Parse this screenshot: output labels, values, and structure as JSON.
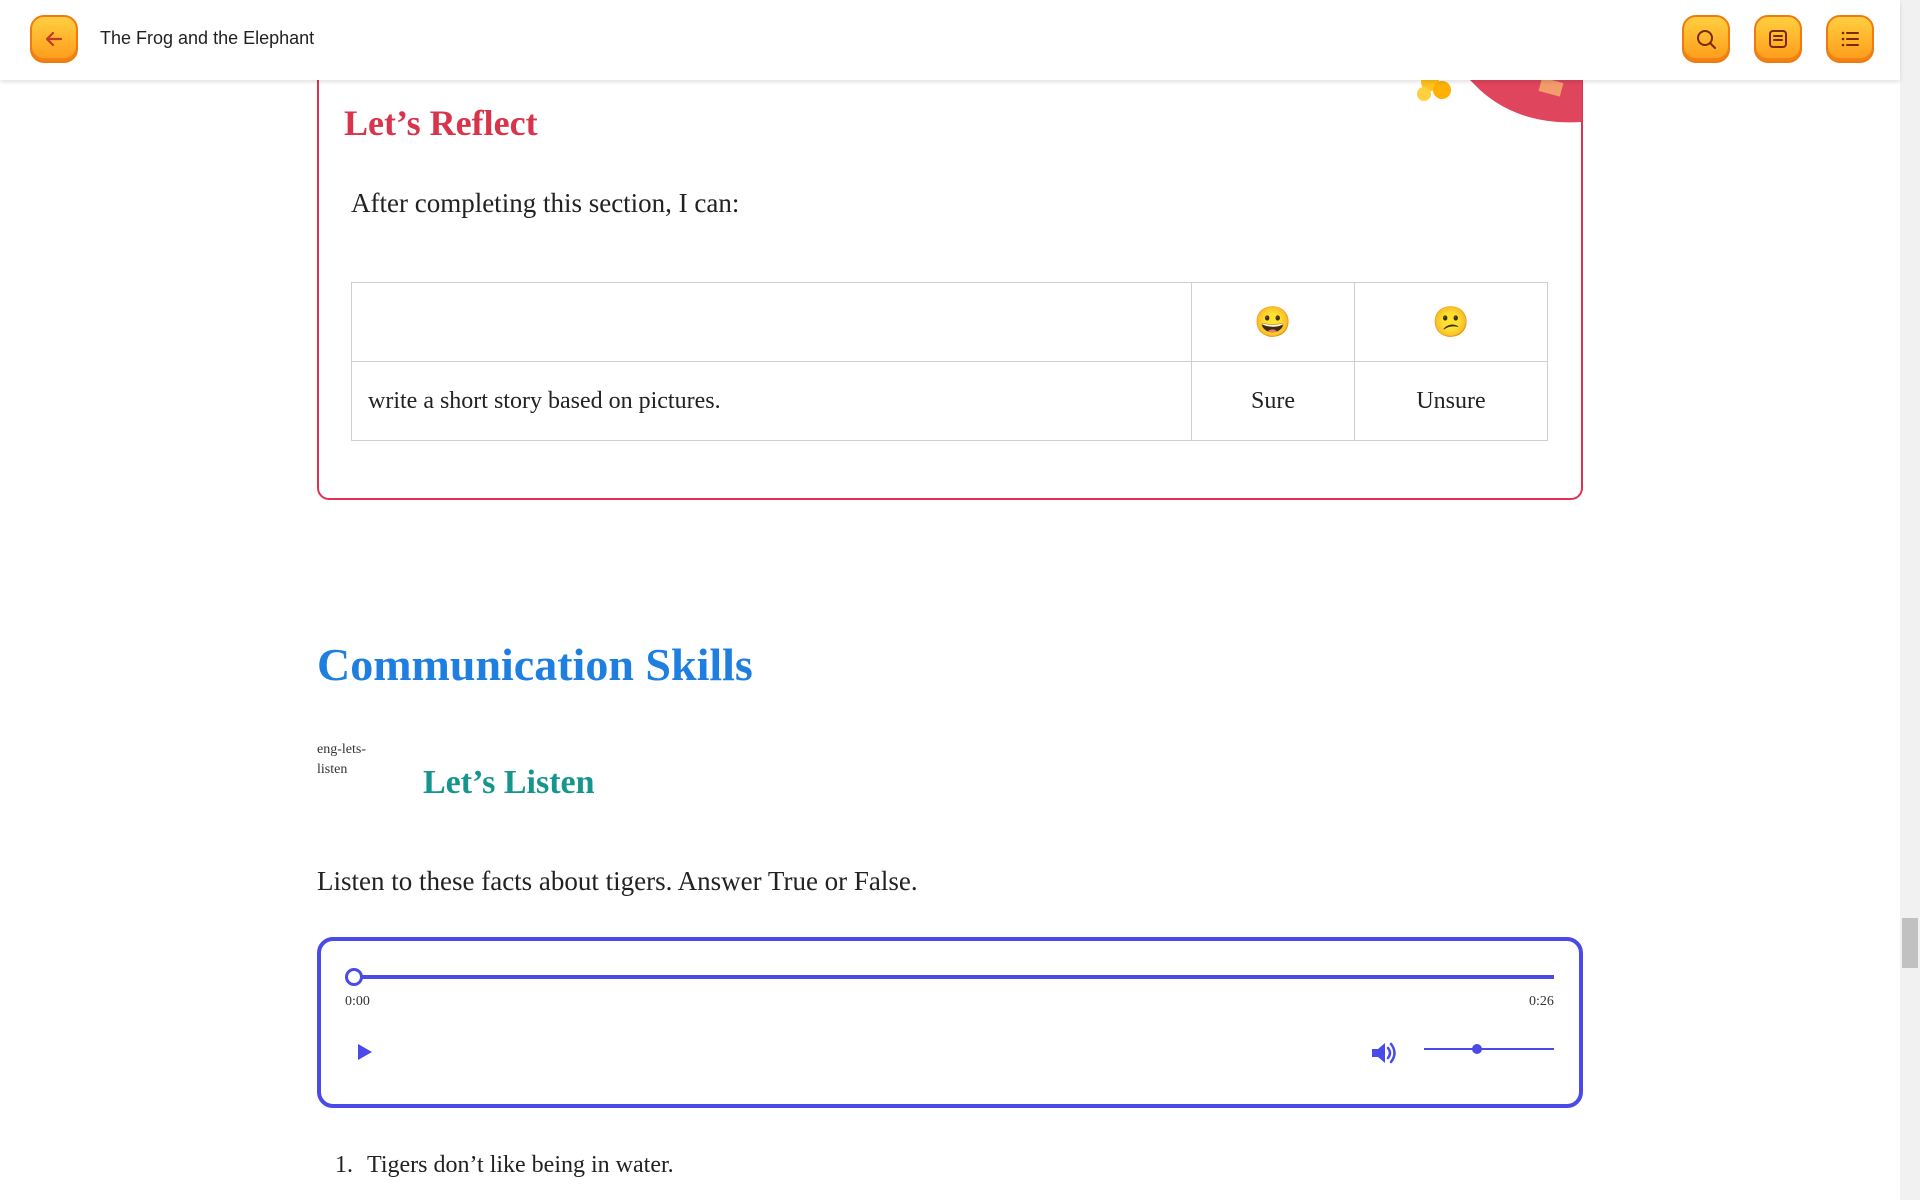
{
  "header": {
    "title": "The Frog and the Elephant",
    "back_icon": "arrow-left-icon",
    "search_icon": "search-icon",
    "notes_icon": "notes-icon",
    "toc_icon": "list-icon",
    "accent": "#ff9a1a"
  },
  "reflect": {
    "title": "Let’s Reflect",
    "intro": "After completing this section, I can:",
    "header_row": {
      "statement": "",
      "sure_emoji": "😀",
      "unsure_emoji": "😕"
    },
    "rows": [
      {
        "statement": "write a short story based on pictures.",
        "sure": "Sure",
        "unsure": "Unsure"
      }
    ],
    "border_color": "#e0324f"
  },
  "communication": {
    "title": "Communication Skills",
    "listen_image_alt": "eng-lets-listen",
    "listen_title": "Let’s Listen",
    "listen_intro": "Listen to these facts about tigers. Answer True or False."
  },
  "audio": {
    "current_time": "0:00",
    "duration": "0:26",
    "progress": 0,
    "volume": 0.4,
    "accent": "#4a4ae8"
  },
  "questions": [
    {
      "number": "1.",
      "text": "Tigers don’t like being in water."
    }
  ]
}
